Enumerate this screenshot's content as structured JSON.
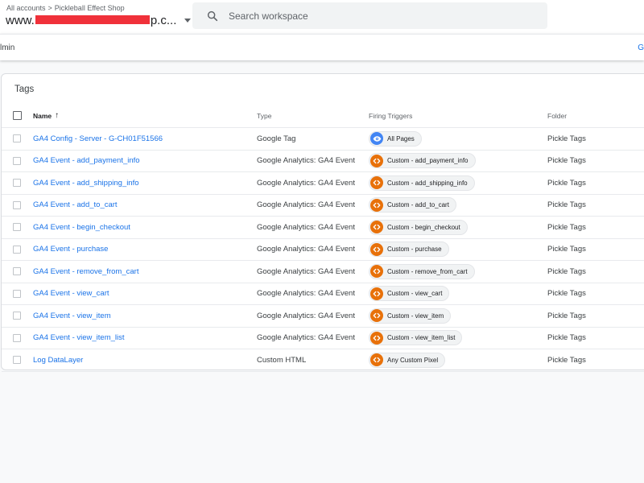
{
  "header": {
    "breadcrumb_root": "All accounts",
    "breadcrumb_separator": ">",
    "breadcrumb_account": "Pickleball Effect Shop",
    "container_prefix": "www.",
    "container_suffix": "p.c...",
    "search_placeholder": "Search workspace"
  },
  "subbar": {
    "left_text": "lmin",
    "right_text": "G"
  },
  "tags_card": {
    "title": "Tags",
    "columns": {
      "name": "Name",
      "type": "Type",
      "triggers": "Firing Triggers",
      "folder": "Folder"
    },
    "rows": [
      {
        "name": "GA4 Config - Server - G-CH01F51566",
        "type": "Google Tag",
        "trigger": "All Pages",
        "trigger_icon": "eye-icon",
        "folder": "Pickle Tags"
      },
      {
        "name": "GA4 Event - add_payment_info",
        "type": "Google Analytics: GA4 Event",
        "trigger": "Custom - add_payment_info",
        "trigger_icon": "code-icon",
        "folder": "Pickle Tags"
      },
      {
        "name": "GA4 Event - add_shipping_info",
        "type": "Google Analytics: GA4 Event",
        "trigger": "Custom - add_shipping_info",
        "trigger_icon": "code-icon",
        "folder": "Pickle Tags"
      },
      {
        "name": "GA4 Event - add_to_cart",
        "type": "Google Analytics: GA4 Event",
        "trigger": "Custom - add_to_cart",
        "trigger_icon": "code-icon",
        "folder": "Pickle Tags"
      },
      {
        "name": "GA4 Event - begin_checkout",
        "type": "Google Analytics: GA4 Event",
        "trigger": "Custom - begin_checkout",
        "trigger_icon": "code-icon",
        "folder": "Pickle Tags"
      },
      {
        "name": "GA4 Event - purchase",
        "type": "Google Analytics: GA4 Event",
        "trigger": "Custom - purchase",
        "trigger_icon": "code-icon",
        "folder": "Pickle Tags"
      },
      {
        "name": "GA4 Event - remove_from_cart",
        "type": "Google Analytics: GA4 Event",
        "trigger": "Custom - remove_from_cart",
        "trigger_icon": "code-icon",
        "folder": "Pickle Tags"
      },
      {
        "name": "GA4 Event - view_cart",
        "type": "Google Analytics: GA4 Event",
        "trigger": "Custom - view_cart",
        "trigger_icon": "code-icon",
        "folder": "Pickle Tags"
      },
      {
        "name": "GA4 Event - view_item",
        "type": "Google Analytics: GA4 Event",
        "trigger": "Custom - view_item",
        "trigger_icon": "code-icon",
        "folder": "Pickle Tags"
      },
      {
        "name": "GA4 Event - view_item_list",
        "type": "Google Analytics: GA4 Event",
        "trigger": "Custom - view_item_list",
        "trigger_icon": "code-icon",
        "folder": "Pickle Tags"
      },
      {
        "name": "Log DataLayer",
        "type": "Custom HTML",
        "trigger": "Any Custom Pixel",
        "trigger_icon": "code-icon",
        "folder": "Pickle Tags"
      }
    ]
  },
  "colors": {
    "link": "#1a73e8",
    "code_trigger": "#e8710a",
    "pageview_trigger": "#4285f4",
    "redaction": "#f0313a"
  }
}
